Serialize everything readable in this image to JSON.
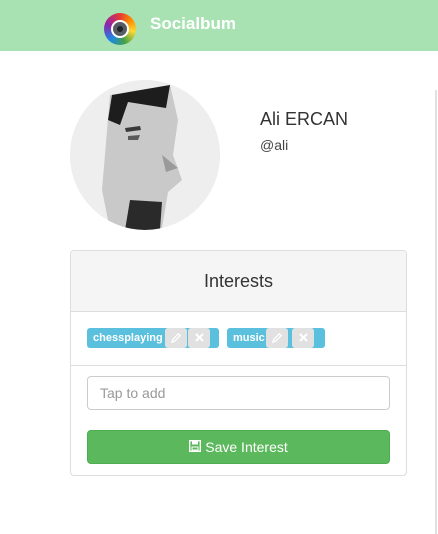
{
  "navbar": {
    "brand": "Socialbum",
    "logo_icon": "camera-lens-icon"
  },
  "profile": {
    "name": "Ali ERCAN",
    "handle": "@ali",
    "avatar_icon": "profile-photo"
  },
  "interests": {
    "title": "Interests",
    "tags": [
      {
        "label": "chessplaying",
        "edit_icon": "edit-icon",
        "remove_icon": "close-icon"
      },
      {
        "label": "music",
        "edit_icon": "edit-icon",
        "remove_icon": "close-icon"
      }
    ],
    "input_placeholder": "Tap to add",
    "save_label": "Save Interest",
    "save_icon": "floppy-disk-icon"
  },
  "colors": {
    "navbar": "#a8e2b3",
    "tag": "#5bc0de",
    "save_button": "#5cb85c"
  }
}
